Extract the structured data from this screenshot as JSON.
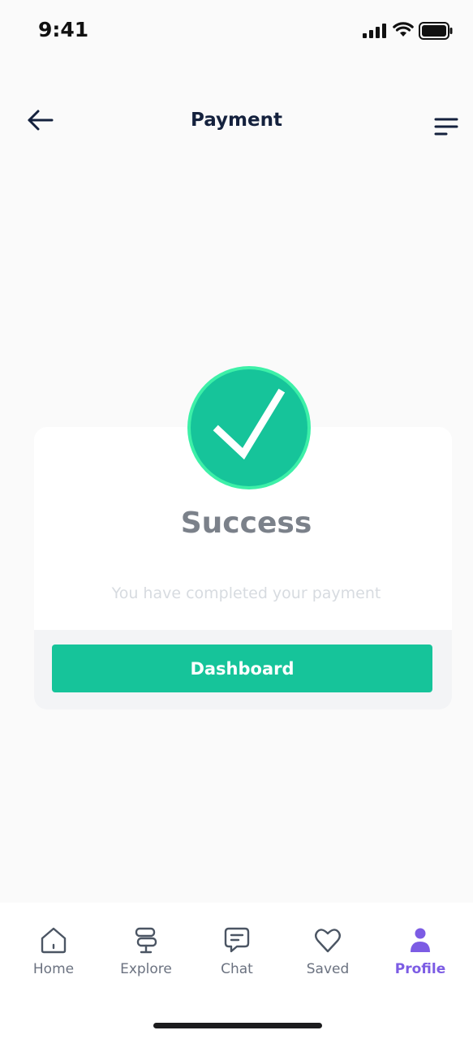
{
  "status_bar": {
    "time": "9:41"
  },
  "header": {
    "title": "Payment"
  },
  "card": {
    "title": "Success",
    "subtitle": "You have completed your payment",
    "button_label": "Dashboard"
  },
  "tab_bar": {
    "items": [
      {
        "label": "Home",
        "icon": "home-icon"
      },
      {
        "label": "Explore",
        "icon": "signpost-icon"
      },
      {
        "label": "Chat",
        "icon": "chat-icon"
      },
      {
        "label": "Saved",
        "icon": "heart-icon"
      },
      {
        "label": "Profile",
        "icon": "user-icon",
        "active": true
      }
    ]
  },
  "colors": {
    "accent": "#16c49a",
    "check_ring": "#3df0a8",
    "active_tab": "#7c5ce4",
    "title_text": "#14213d"
  }
}
